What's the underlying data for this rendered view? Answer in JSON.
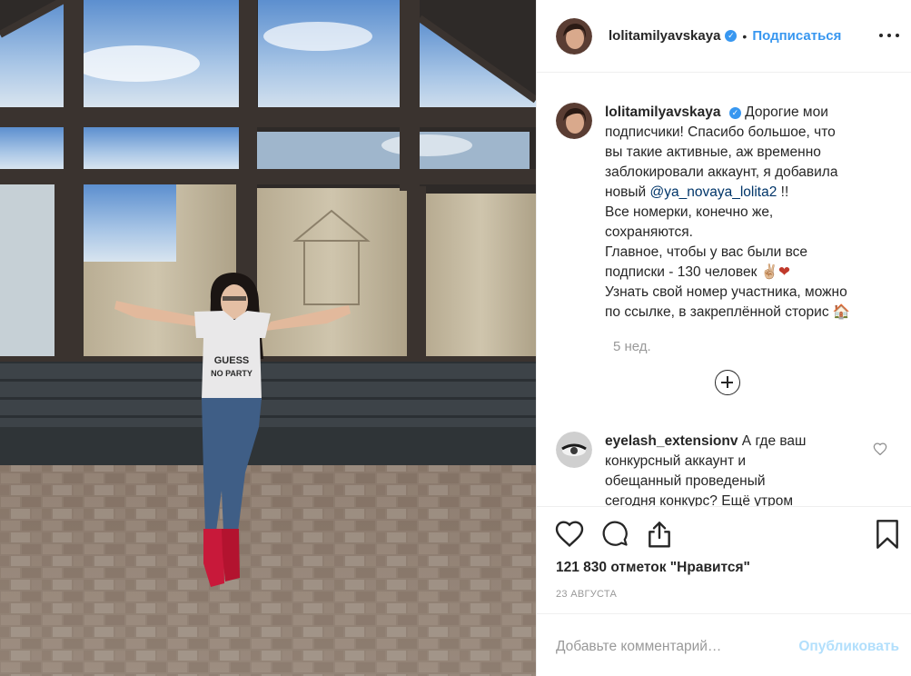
{
  "post": {
    "author": "lolitamilyavskaya",
    "follow_label": "Подписаться",
    "separator": "•",
    "more_icon": "more-dots-icon"
  },
  "caption": {
    "username": "lolitamilyavskaya",
    "line1": "Дорогие мои",
    "line2": "подписчики! Спасибо большое, что",
    "line3": "вы такие активные, аж временно",
    "line4": "заблокировали аккаунт, я добавила",
    "line5_prefix": "новый",
    "mention": "@ya_novaya_lolita2",
    "line5_suffix": "!!",
    "line6": "Все номерки, конечно же,",
    "line7": "сохраняются.",
    "line8": "Главное, чтобы у вас были все",
    "line9_text": "подписки - 130 человек",
    "line9_emoji": "✌🏼❤",
    "line10": "Узнать свой номер участника, можно",
    "line11_text": "по ссылке, в закреплённой сторис",
    "line11_emoji": "🏠",
    "time_ago": "5 нед."
  },
  "comment": {
    "username": "eyelash_extensionv",
    "text_line1": "А где ваш",
    "text_line2": "конкурсный аккаунт и",
    "text_line3": "обещанный проведеный",
    "text_line4": "сегодня конкурс? Ещё утром"
  },
  "stats": {
    "likes": "121 830 отметок \"Нравится\"",
    "date": "23 августа"
  },
  "add_comment": {
    "placeholder": "Добавьте комментарий…",
    "publish_label": "Опубликовать"
  },
  "icons": [
    "heart-icon",
    "comment-icon",
    "share-icon",
    "bookmark-icon",
    "plus-circle-icon",
    "small-heart-icon",
    "verified-badge-icon"
  ],
  "colors": {
    "accent": "#3897f0",
    "text": "#262626",
    "muted": "#999999",
    "mention": "#003569",
    "publish_disabled": "#b2dffc",
    "border": "#efefef"
  }
}
